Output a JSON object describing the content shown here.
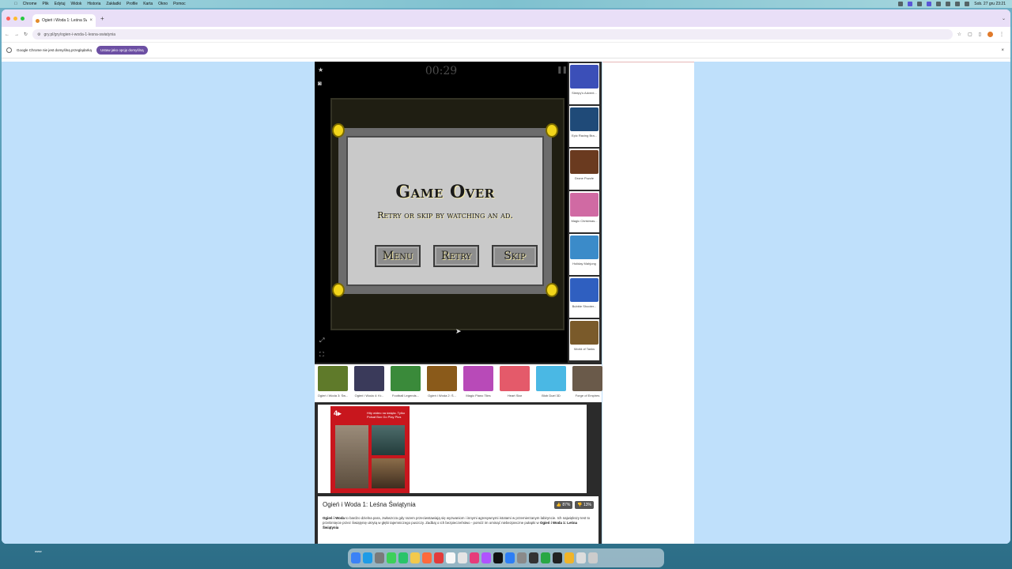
{
  "menubar": {
    "items": [
      "Chrome",
      "Plik",
      "Edytuj",
      "Widok",
      "Historia",
      "Zakładki",
      "Profile",
      "Karta",
      "Okno",
      "Pomoc"
    ],
    "clock": "Sob. 27 gru 23:21"
  },
  "browser": {
    "tab_title": "Ogień i Woda 1: Leśna Świątynia",
    "url": "gry.pl/gry/ogien-i-woda-1-lesna-swiatynia",
    "infobar_text": "Google Chrome nie jest domyślną przeglądarką",
    "infobar_button": "Ustaw jako opcję domyślną"
  },
  "game": {
    "timer": "00:29",
    "overlay_title": "Game Over",
    "overlay_subtitle": "Retry or skip by watching an ad.",
    "buttons": {
      "menu": "Menu",
      "retry": "Retry",
      "skip": "Skip"
    }
  },
  "side_games": [
    {
      "label": "Sleepy's Advent...",
      "color": "#3b4fb8"
    },
    {
      "label": "Epic Racing Bra...",
      "color": "#1f4a78"
    },
    {
      "label": "Drone Puzzle",
      "color": "#6a3a1f"
    },
    {
      "label": "Magic Christmas...",
      "color": "#d06aa3"
    },
    {
      "label": "Holiday Mahjong",
      "color": "#3b8bc9"
    },
    {
      "label": "Bubble Shooter...",
      "color": "#2f5fc0"
    },
    {
      "label": "World of Tanks",
      "color": "#7a5a2a"
    }
  ],
  "bottom_games": [
    {
      "label": "Ogień i Woda 3: Św...",
      "color": "#5f7a2a"
    },
    {
      "label": "Ogień i Woda 4: Kr...",
      "color": "#3a3a5a"
    },
    {
      "label": "Football Legends...",
      "color": "#3a8a3a"
    },
    {
      "label": "Ogień i Woda 2: Ś...",
      "color": "#8a5a1a"
    },
    {
      "label": "Magic Piano Tiles",
      "color": "#b84ab8"
    },
    {
      "label": "Heart Star",
      "color": "#e45a6a"
    },
    {
      "label": "Blob Duel 3D",
      "color": "#4ab8e4"
    },
    {
      "label": "Forge of Empires",
      "color": "#6a5a4a"
    }
  ],
  "ad": {
    "logo": "4▸",
    "text": "Hity wideo na święta. Tylko Polsat Box Go Play Plus"
  },
  "info": {
    "title": "Ogień i Woda 1: Leśna Świątynia",
    "likes": "87%",
    "dislikes": "13%",
    "desc_bold": "Ogień i Woda",
    "desc": " to bardzo dzielna para, zwłaszcza gdy razem przeciwstawiają się wyzwaniom i innymi agresywnymi istotami w przemierzanym labiryncie. Ich największy test to przebrnięcie przez Świątynię ukrytą w głębi tajemniczego puszczy. Zadbaj o ich bezpieczeństwo - pomóż im ominąć niebezpieczne pułapki w ",
    "desc_bold_end": "Ogień i Woda 1: Leśna Świątynia"
  },
  "desktop_label": "www",
  "colors": {
    "accent": "#6c4fa3",
    "page_bg": "#bfe0fb",
    "ad_red": "#c8161d",
    "bolt": "#f2d51a"
  }
}
